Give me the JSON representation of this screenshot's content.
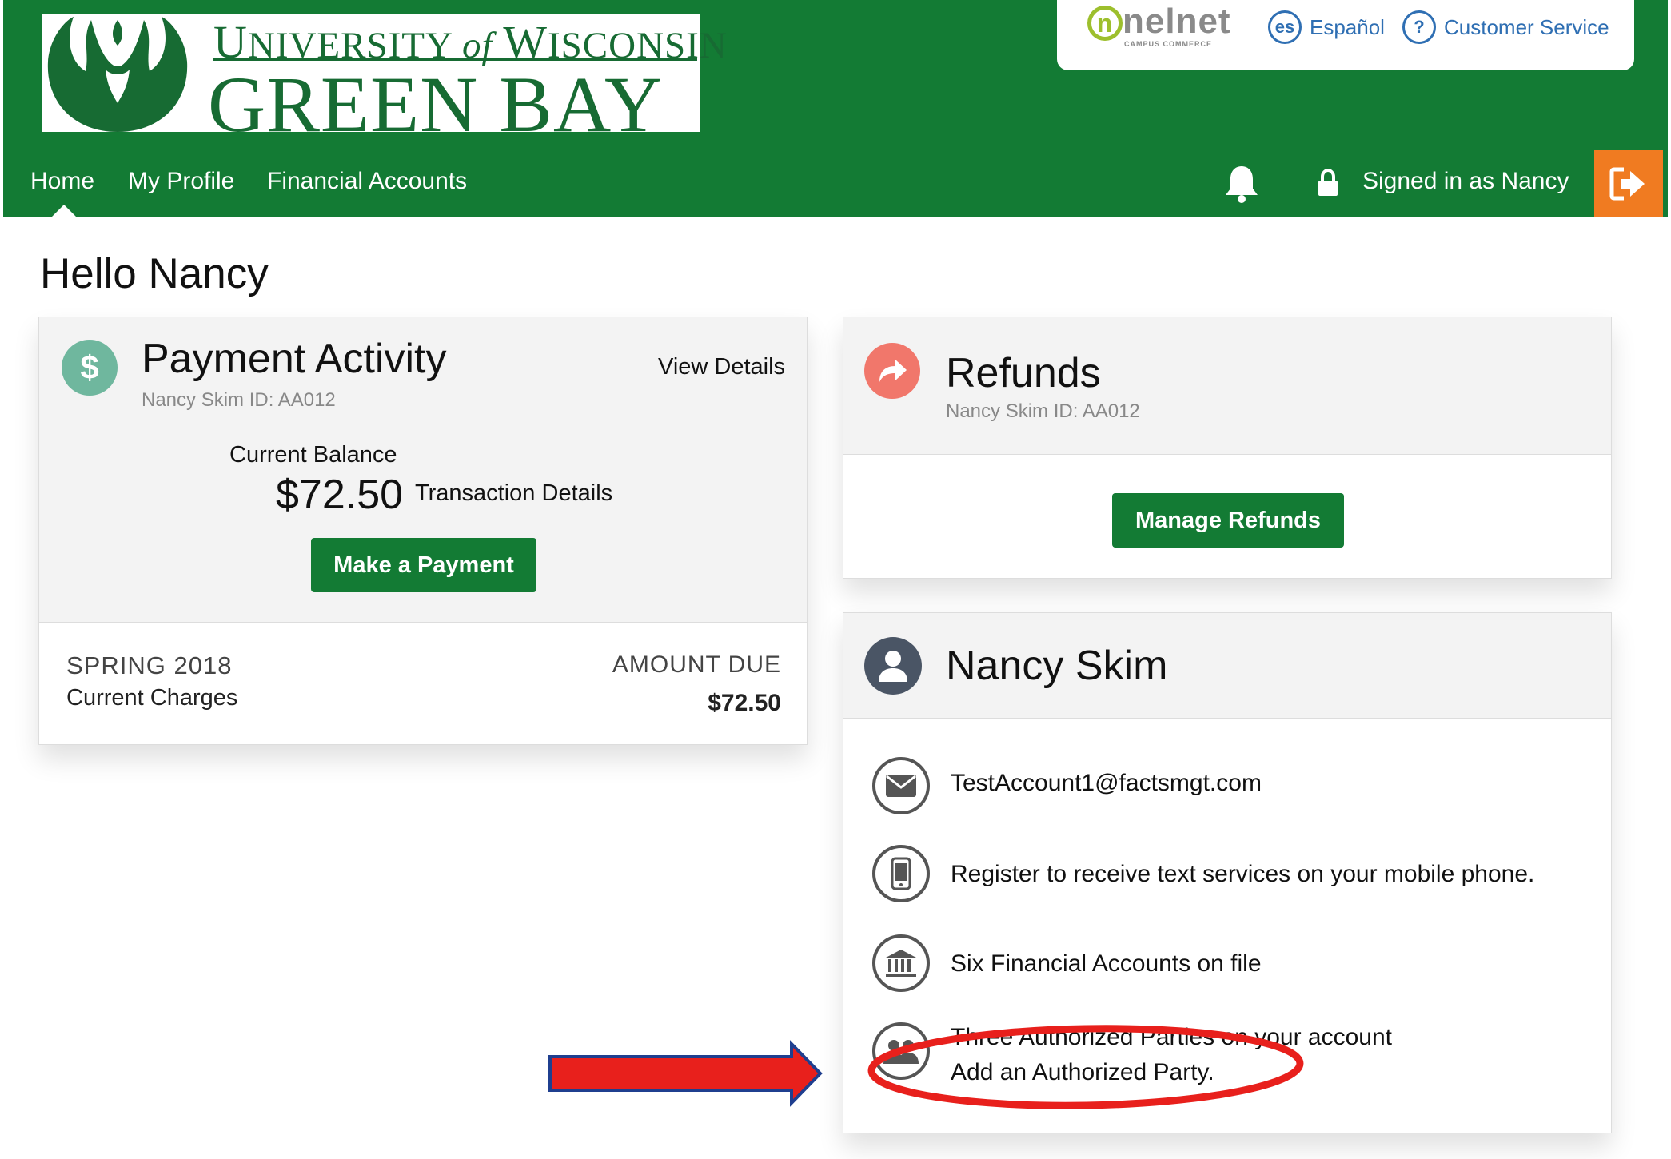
{
  "header": {
    "logo_line1_u": "U",
    "logo_line1_a": "NIVERSITY",
    "logo_line1_of": "of",
    "logo_line1_w": "W",
    "logo_line1_b": "ISCONSIN",
    "logo_line2": "GREEN BAY",
    "vendor_logo": "nelnet",
    "vendor_sub": "CAMPUS COMMERCE",
    "espanol_icon_text": "es",
    "espanol_label": "Español",
    "help_icon_text": "?",
    "customer_service_label": "Customer Service",
    "nav": [
      {
        "label": "Home"
      },
      {
        "label": "My Profile"
      },
      {
        "label": "Financial Accounts"
      }
    ],
    "signed_in_label": "Signed in as Nancy",
    "brand_color": "#137b34",
    "logout_color": "#f07b21"
  },
  "greeting": "Hello Nancy",
  "payment_activity": {
    "icon_text": "$",
    "title": "Payment Activity",
    "subtitle": "Nancy Skim ID: AA012",
    "view_details": "View Details",
    "balance_label": "Current Balance",
    "balance_amount": "$72.50",
    "transaction_details": "Transaction Details",
    "pay_button": "Make a Payment",
    "term": "SPRING 2018",
    "charges_label": "Current Charges",
    "amount_due_label": "AMOUNT DUE",
    "amount_due": "$72.50"
  },
  "refunds": {
    "title": "Refunds",
    "subtitle": "Nancy Skim ID: AA012",
    "button": "Manage Refunds"
  },
  "account": {
    "name": "Nancy Skim",
    "email": "TestAccount1@factsmgt.com",
    "text_services": "Register to receive text services on your mobile phone.",
    "financial_accounts": "Six Financial Accounts on file",
    "authorized_parties": "Three Authorized Parties on your account",
    "add_authorized_party": "Add an Authorized Party."
  },
  "annotation_color": "#e8201c"
}
